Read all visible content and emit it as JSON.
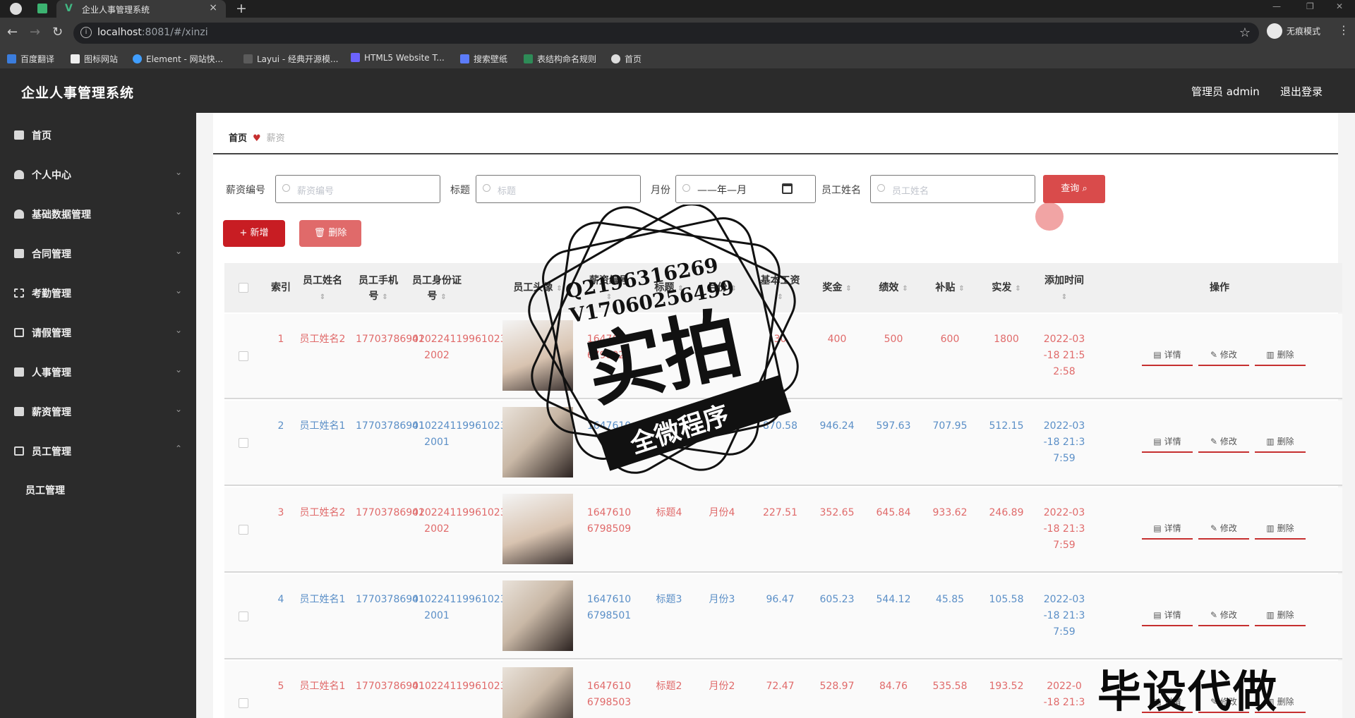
{
  "browser": {
    "tab_title": "企业人事管理系统",
    "url_host": "localhost",
    "url_path": ":8081/#/xinzi",
    "incognito_label": "无痕模式",
    "bookmarks": [
      "百度翻译",
      "图标网站",
      "Element - 网站快...",
      "Layui - 经典开源模...",
      "HTML5 Website T...",
      "搜索壁纸",
      "表结构命名规则",
      "首页"
    ]
  },
  "app": {
    "title": "企业人事管理系统",
    "admin_label": "管理员 admin",
    "logout_label": "退出登录"
  },
  "sidebar": {
    "items": [
      {
        "label": "首页",
        "icon": "home-icon",
        "chevron": false
      },
      {
        "label": "个人中心",
        "icon": "user-icon",
        "chevron": true
      },
      {
        "label": "基础数据管理",
        "icon": "user-icon",
        "chevron": true
      },
      {
        "label": "合同管理",
        "icon": "contract-icon",
        "chevron": true
      },
      {
        "label": "考勤管理",
        "icon": "scan-icon",
        "chevron": true
      },
      {
        "label": "请假管理",
        "icon": "copy-icon",
        "chevron": true
      },
      {
        "label": "人事管理",
        "icon": "doc-icon",
        "chevron": true
      },
      {
        "label": "薪资管理",
        "icon": "money-icon",
        "chevron": true
      },
      {
        "label": "员工管理",
        "icon": "chat-icon",
        "chevron": true,
        "expanded": true
      }
    ],
    "sub_item": "员工管理"
  },
  "breadcrumb": {
    "home": "首页",
    "current": "薪资"
  },
  "filters": {
    "salary_no_label": "薪资编号",
    "salary_no_placeholder": "薪资编号",
    "title_label": "标题",
    "title_placeholder": "标题",
    "month_label": "月份",
    "month_value": "——年—月",
    "name_label": "员工姓名",
    "name_placeholder": "员工姓名",
    "search_label": "查询"
  },
  "actions": {
    "add_label": "新增",
    "delete_label": "删除"
  },
  "table": {
    "headers": {
      "index": "索引",
      "name": "员工姓名",
      "phone": "员工手机号",
      "idcard": "员工身份证号",
      "avatar": "员工头像",
      "salary_no": "薪资编号",
      "title": "标题",
      "month": "月份",
      "base": "基本工资",
      "bonus": "奖金",
      "perf": "绩效",
      "allowance": "补贴",
      "actual": "实发",
      "time": "添加时间",
      "ops": "操作"
    },
    "op_labels": {
      "detail": "详情",
      "edit": "修改",
      "delete": "删除"
    },
    "rows": [
      {
        "index": "1",
        "name": "员工姓名2",
        "phone": "17703786902",
        "idcard": "410224119961023\n2002",
        "salary_no": "1647610\n6798028",
        "title": "",
        "month": "",
        "base": "30",
        "bonus": "400",
        "perf": "500",
        "allowance": "600",
        "actual": "1800",
        "time": "2022-03\n-18 21:5\n2:58",
        "tone": "red",
        "avatar": "male"
      },
      {
        "index": "2",
        "name": "员工姓名1",
        "phone": "17703786901",
        "idcard": "410224119961023\n2001",
        "salary_no": "1647610",
        "title": "",
        "month": "",
        "base": "870.58",
        "bonus": "946.24",
        "perf": "597.63",
        "allowance": "707.95",
        "actual": "512.15",
        "time": "2022-03\n-18 21:3\n7:59",
        "tone": "blue",
        "avatar": "female"
      },
      {
        "index": "3",
        "name": "员工姓名2",
        "phone": "17703786902",
        "idcard": "410224119961023\n2002",
        "salary_no": "1647610\n6798509",
        "title": "标题4",
        "month": "月份4",
        "base": "227.51",
        "bonus": "352.65",
        "perf": "645.84",
        "allowance": "933.62",
        "actual": "246.89",
        "time": "2022-03\n-18 21:3\n7:59",
        "tone": "red",
        "avatar": "male"
      },
      {
        "index": "4",
        "name": "员工姓名1",
        "phone": "17703786901",
        "idcard": "410224119961023\n2001",
        "salary_no": "1647610\n6798501",
        "title": "标题3",
        "month": "月份3",
        "base": "96.47",
        "bonus": "605.23",
        "perf": "544.12",
        "allowance": "45.85",
        "actual": "105.58",
        "time": "2022-03\n-18 21:3\n7:59",
        "tone": "blue",
        "avatar": "female"
      },
      {
        "index": "5",
        "name": "员工姓名1",
        "phone": "17703786901",
        "idcard": "410224119961023",
        "salary_no": "1647610\n6798503",
        "title": "标题2",
        "month": "月份2",
        "base": "72.47",
        "bonus": "528.97",
        "perf": "84.76",
        "allowance": "535.58",
        "actual": "193.52",
        "time": "2022-0\n-18 21:3",
        "tone": "red",
        "avatar": "female"
      }
    ]
  },
  "watermark": {
    "qq": "Q2196316269",
    "vx": "V17060256499",
    "main": "实拍",
    "ribbon": "全微程序",
    "corner": "毕设代做"
  },
  "colors": {
    "red": "#e06a6a",
    "blue": "#5b8fc7",
    "accent": "#c81d23"
  }
}
